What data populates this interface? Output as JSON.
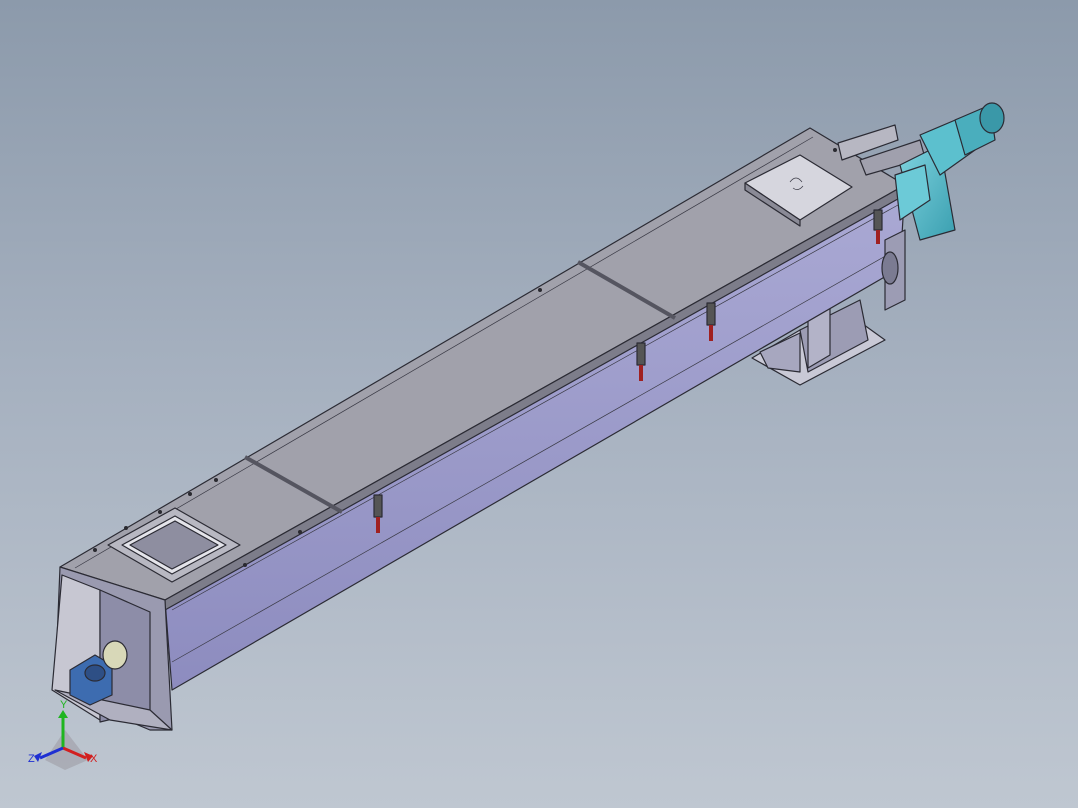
{
  "viewport": {
    "model": "screw-conveyor-assembly"
  },
  "triad": {
    "x_label": "X",
    "y_label": "Y",
    "z_label": "Z",
    "x_color": "#d21f1f",
    "y_color": "#1fb51f",
    "z_color": "#1f2fd2"
  },
  "colors": {
    "background_top": "#8c9aab",
    "background_bottom": "#bfc7d1",
    "trough_side": "#9d9cc9",
    "cover": "#9a9aa4",
    "motor": "#55b8c8",
    "bearing": "#3d6cb0"
  }
}
